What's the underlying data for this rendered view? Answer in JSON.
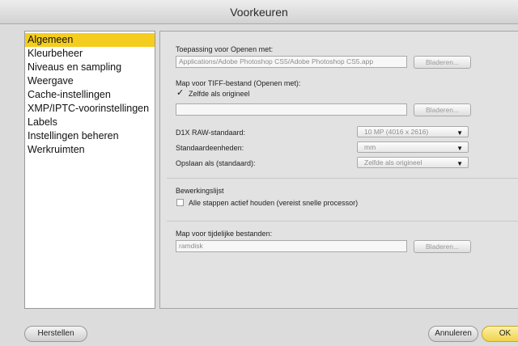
{
  "window": {
    "title": "Voorkeuren"
  },
  "sidebar": {
    "items": [
      {
        "label": "Algemeen",
        "selected": true
      },
      {
        "label": "Kleurbeheer"
      },
      {
        "label": "Niveaus en sampling"
      },
      {
        "label": "Weergave"
      },
      {
        "label": "Cache-instellingen"
      },
      {
        "label": "XMP/IPTC-voorinstellingen"
      },
      {
        "label": "Labels"
      },
      {
        "label": "Instellingen beheren"
      },
      {
        "label": "Werkruimten"
      }
    ]
  },
  "main": {
    "open_app": {
      "label": "Toepassing voor Openen met:",
      "value": "Applications/Adobe Photoshop CS5/Adobe Photoshop CS5.app",
      "browse_label": "Bladeren..."
    },
    "tiff": {
      "label": "Map voor TIFF-bestand (Openen met):",
      "same_as_original_label": "Zelfde als origineel",
      "same_as_original_checked": true,
      "path_value": "",
      "browse_label": "Bladeren..."
    },
    "d1x_raw": {
      "label": "D1X RAW-standaard:",
      "value": "10 MP (4016 x 2616)"
    },
    "units": {
      "label": "Standaardeenheden:",
      "value": "mm"
    },
    "save_as": {
      "label": "Opslaan als (standaard):",
      "value": "Zelfde als origineel"
    },
    "edit_list": {
      "label": "Bewerkingslijst",
      "keep_steps_label": "Alle stappen actief houden (vereist snelle processor)",
      "keep_steps_checked": false
    },
    "temp_folder": {
      "label": "Map voor tijdelijke bestanden:",
      "value": "ramdisk",
      "browse_label": "Bladeren..."
    }
  },
  "footer": {
    "reset_label": "Herstellen",
    "cancel_label": "Annuleren",
    "ok_label": "OK"
  },
  "colors": {
    "selection": "#f5cd1e",
    "default_button": "#f1d34a"
  },
  "icons": {
    "checkmark": "checkmark-icon",
    "dropdown": "dropdown-arrow-icon"
  }
}
